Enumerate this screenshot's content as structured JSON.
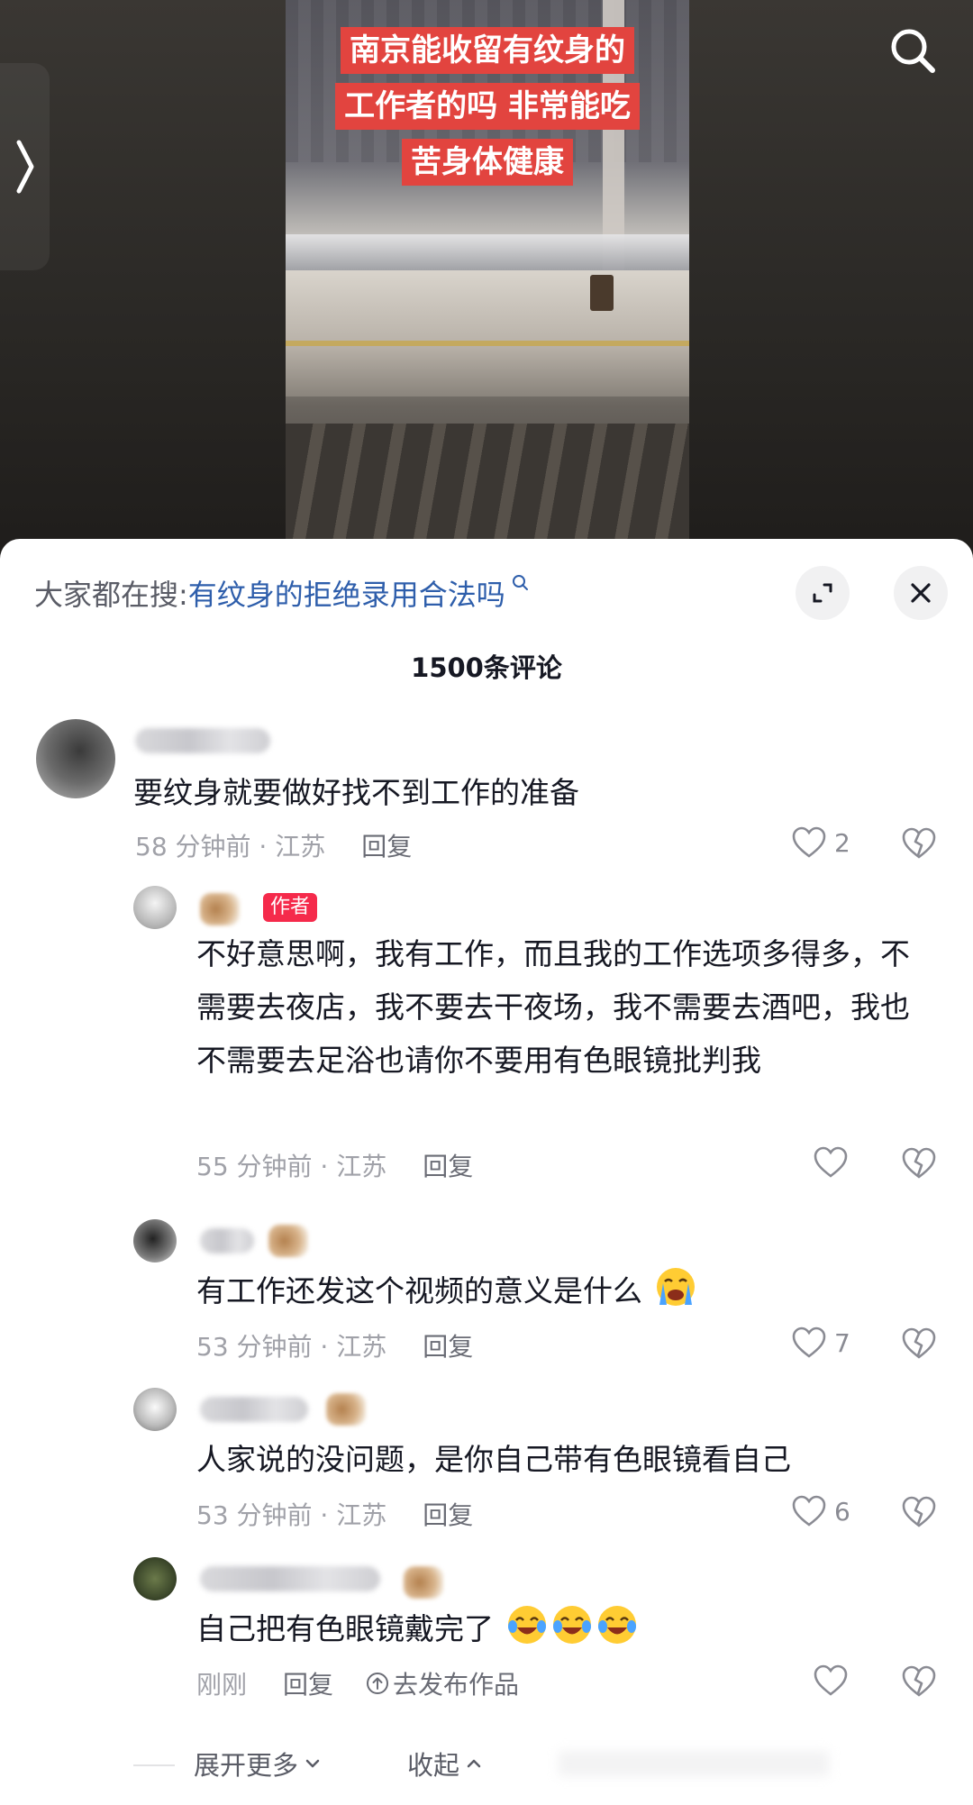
{
  "video": {
    "overlay_lines": [
      "南京能收留有纹身的",
      "工作者的吗 非常能吃",
      "苦身体健康"
    ],
    "overlay_color": "#e2443f"
  },
  "panel": {
    "search_prefix": "大家都在搜:",
    "search_term": "有纹身的拒绝录用合法吗",
    "comment_count": "1500条评论"
  },
  "comments": [
    {
      "text": "要纹身就要做好找不到工作的准备",
      "time": "58 分钟前 · 江苏",
      "reply": "回复",
      "likes": "2"
    },
    {
      "badge": "作者",
      "text": "不好意思啊，我有工作，而且我的工作选项多得多，不需要去夜店，我不要去干夜场，我不需要去酒吧，我也不需要去足浴也请你不要用有色眼镜批判我",
      "time": "55 分钟前 · 江苏",
      "reply": "回复",
      "likes": ""
    },
    {
      "text": "有工作还发这个视频的意义是什么",
      "emoji": "loudly-crying-face",
      "time": "53 分钟前 · 江苏",
      "reply": "回复",
      "likes": "7"
    },
    {
      "text": "人家说的没问题，是你自己带有色眼镜看自己",
      "time": "53 分钟前 · 江苏",
      "reply": "回复",
      "likes": "6"
    },
    {
      "text": "自己把有色眼镜戴完了",
      "emoji": "tears-of-joy-face x3",
      "time": "刚刚",
      "reply": "回复",
      "publish": "去发布作品",
      "likes": ""
    }
  ],
  "footer": {
    "expand_more": "展开更多",
    "collapse": "收起"
  },
  "icons": [
    "search-icon",
    "chevron-left-icon",
    "expand-icon",
    "close-icon",
    "heart-icon",
    "broken-heart-icon",
    "chevron-down-icon",
    "chevron-up-icon",
    "upload-icon"
  ]
}
